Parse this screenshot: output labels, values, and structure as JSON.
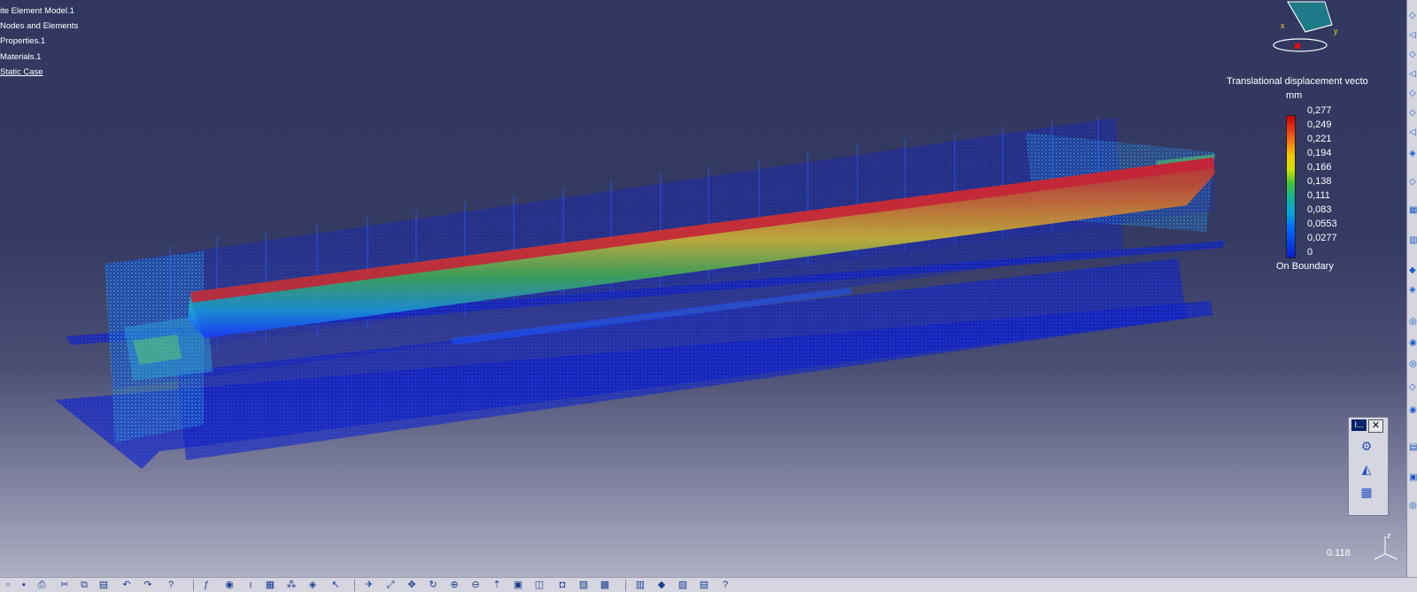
{
  "tree": {
    "items": [
      "ite Element Model.1",
      "Nodes and Elements",
      "Properties.1",
      "Materials.1",
      "Static Case"
    ]
  },
  "legend": {
    "title": "Translational displacement vecto",
    "unit": "mm",
    "values": [
      "0,277",
      "0,249",
      "0,221",
      "0,194",
      "0,166",
      "0,138",
      "0,111",
      "0,083",
      "0,0553",
      "0,0277",
      "0"
    ],
    "boundary_label": "On Boundary",
    "colors": [
      "#c80000",
      "#f07a10",
      "#f4c800",
      "#3ac23a",
      "#0aa6dc",
      "#0a1ed2"
    ]
  },
  "scale": {
    "value": "0.118"
  },
  "compass": {
    "x_label": "x",
    "y_label": "y"
  },
  "axis": {
    "z_label": "z"
  },
  "mini_panel": {
    "title": "I...",
    "close": "✕"
  }
}
